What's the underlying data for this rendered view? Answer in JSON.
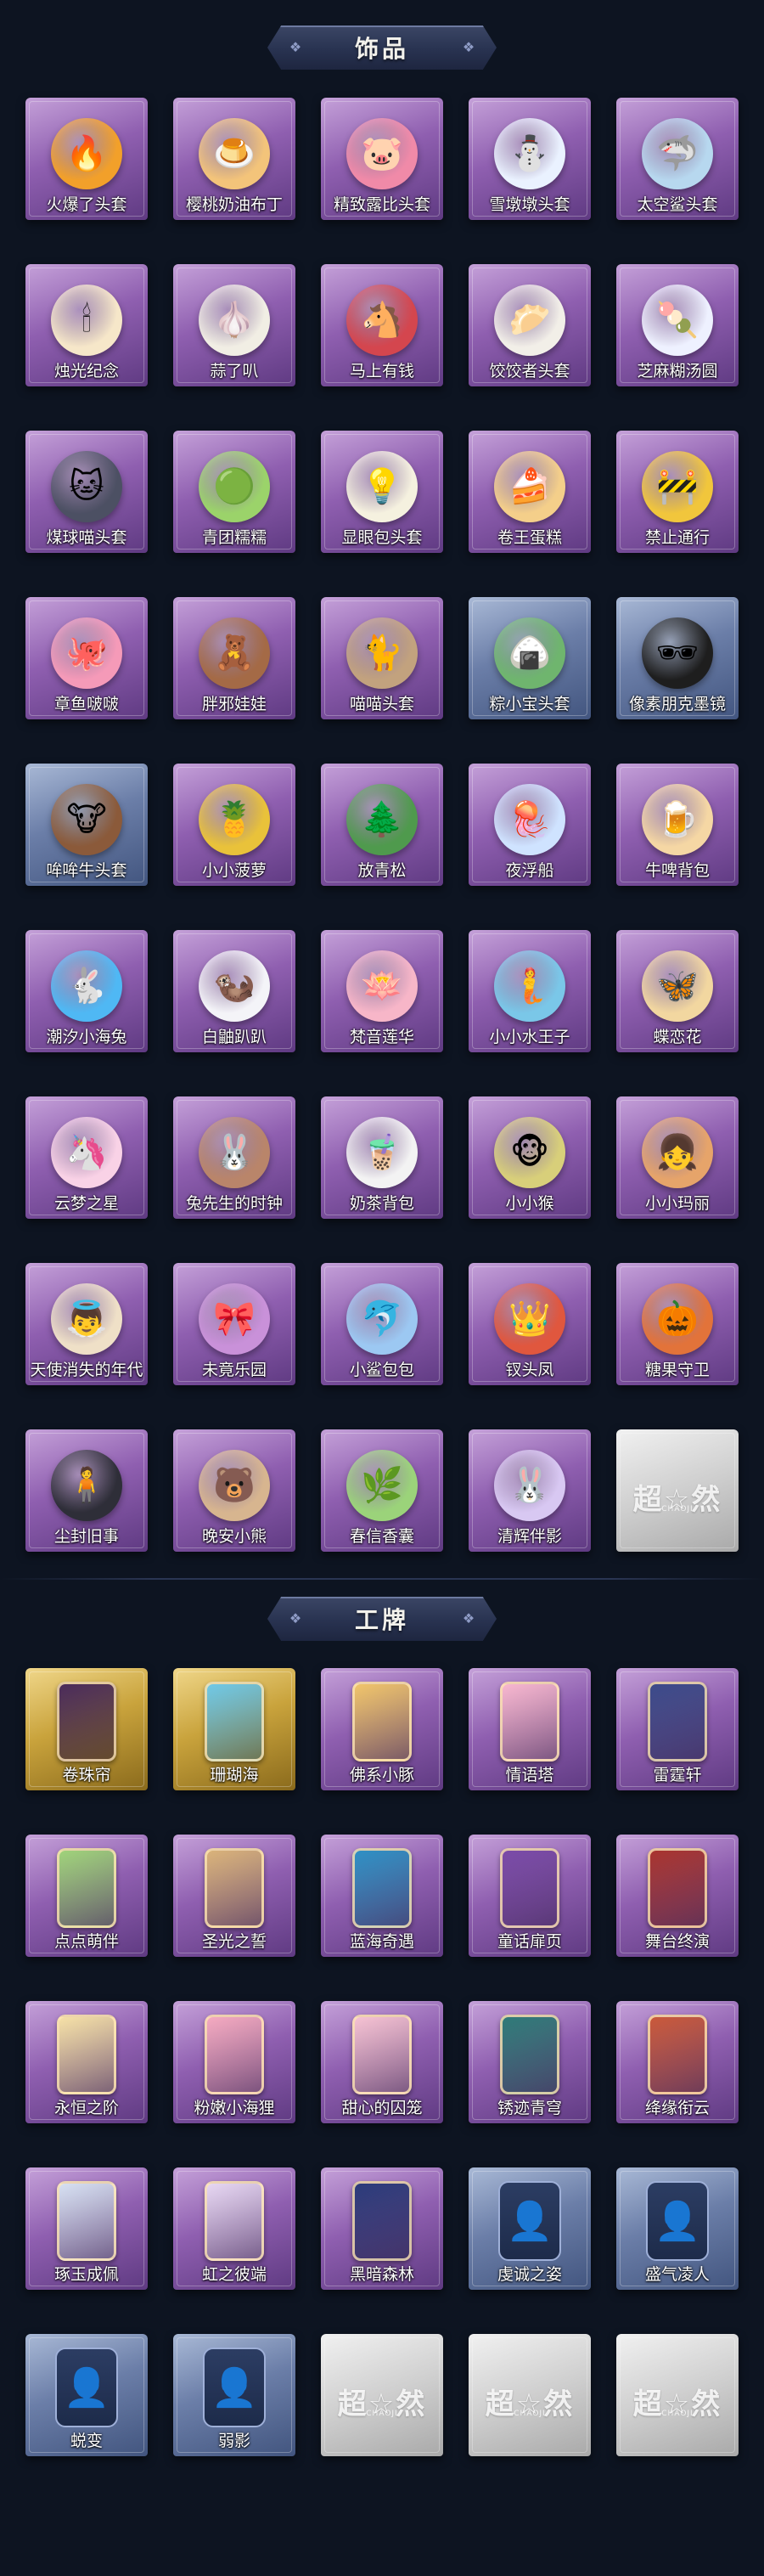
{
  "sections": [
    {
      "title": "饰品",
      "items": [
        {
          "label": "火爆了头套",
          "style": "purple",
          "icon": "🔥",
          "color": "#f2a02a"
        },
        {
          "label": "樱桃奶油布丁",
          "style": "purple",
          "icon": "🍮",
          "color": "#f3c47a"
        },
        {
          "label": "精致露比头套",
          "style": "purple",
          "icon": "🐷",
          "color": "#f08aa8"
        },
        {
          "label": "雪墩墩头套",
          "style": "purple",
          "icon": "⛄",
          "color": "#eaf2ff"
        },
        {
          "label": "太空鲨头套",
          "style": "purple",
          "icon": "🦈",
          "color": "#b7d8ef"
        },
        {
          "label": "烛光纪念",
          "style": "purple",
          "icon": "🕯",
          "color": "#f6e7c9"
        },
        {
          "label": "蒜了叭",
          "style": "purple",
          "icon": "🧄",
          "color": "#f1eee4"
        },
        {
          "label": "马上有钱",
          "style": "purple",
          "icon": "🐴",
          "color": "#d4464e"
        },
        {
          "label": "饺饺者头套",
          "style": "purple",
          "icon": "🥟",
          "color": "#f2efe8"
        },
        {
          "label": "芝麻糊汤圆",
          "style": "purple",
          "icon": "🍡",
          "color": "#eef1ff"
        },
        {
          "label": "煤球喵头套",
          "style": "purple",
          "icon": "🐱",
          "color": "#4c5063"
        },
        {
          "label": "青团糯糯",
          "style": "purple",
          "icon": "🟢",
          "color": "#9bd36a"
        },
        {
          "label": "显眼包头套",
          "style": "purple",
          "icon": "💡",
          "color": "#f5f1df"
        },
        {
          "label": "卷王蛋糕",
          "style": "purple",
          "icon": "🍰",
          "color": "#f4cf8a"
        },
        {
          "label": "禁止通行",
          "style": "purple",
          "icon": "🚧",
          "color": "#f1c63c"
        },
        {
          "label": "章鱼啵啵",
          "style": "purple",
          "icon": "🐙",
          "color": "#f59ab8"
        },
        {
          "label": "胖邪娃娃",
          "style": "purple",
          "icon": "🧸",
          "color": "#a46a46"
        },
        {
          "label": "喵喵头套",
          "style": "purple",
          "icon": "🐈",
          "color": "#c2a27e"
        },
        {
          "label": "粽小宝头套",
          "style": "blue",
          "icon": "🍙",
          "color": "#6fb56e"
        },
        {
          "label": "像素朋克墨镜",
          "style": "blue",
          "icon": "🕶",
          "color": "#1e1e1e"
        },
        {
          "label": "哞哞牛头套",
          "style": "blue",
          "icon": "🐮",
          "color": "#8b5a3a"
        },
        {
          "label": "小小菠萝",
          "style": "purple",
          "icon": "🍍",
          "color": "#e9c23a"
        },
        {
          "label": "放青松",
          "style": "purple",
          "icon": "🌲",
          "color": "#4f9a4d"
        },
        {
          "label": "夜浮船",
          "style": "purple",
          "icon": "🪼",
          "color": "#cfe3ff"
        },
        {
          "label": "牛啤背包",
          "style": "purple",
          "icon": "🍺",
          "color": "#f5d7a4"
        },
        {
          "label": "潮汐小海兔",
          "style": "purple",
          "icon": "🐇",
          "color": "#4fb8f4"
        },
        {
          "label": "白鼬趴趴",
          "style": "purple",
          "icon": "🦦",
          "color": "#f4f4f8"
        },
        {
          "label": "梵音莲华",
          "style": "purple",
          "icon": "🪷",
          "color": "#f7b6c8"
        },
        {
          "label": "小小水王子",
          "style": "purple",
          "icon": "🧜",
          "color": "#7ac7e8"
        },
        {
          "label": "蝶恋花",
          "style": "purple",
          "icon": "🦋",
          "color": "#f2d7a0"
        },
        {
          "label": "云梦之星",
          "style": "purple",
          "icon": "🦄",
          "color": "#f9d2e6"
        },
        {
          "label": "兔先生的时钟",
          "style": "purple",
          "icon": "🐰",
          "color": "#b9856a"
        },
        {
          "label": "奶茶背包",
          "style": "purple",
          "icon": "🧋",
          "color": "#f3f3f3"
        },
        {
          "label": "小小猴",
          "style": "purple",
          "icon": "🐵",
          "color": "#d8cf7a"
        },
        {
          "label": "小小玛丽",
          "style": "purple",
          "icon": "👧",
          "color": "#e6a46a"
        },
        {
          "label": "天使消失的年代",
          "style": "purple",
          "icon": "👼",
          "color": "#efe0c7"
        },
        {
          "label": "未竟乐园",
          "style": "purple",
          "icon": "🎀",
          "color": "#c991d9"
        },
        {
          "label": "小鲨包包",
          "style": "purple",
          "icon": "🐬",
          "color": "#9cc8f2"
        },
        {
          "label": "钗头凤",
          "style": "purple",
          "icon": "👑",
          "color": "#e0573e"
        },
        {
          "label": "糖果守卫",
          "style": "purple",
          "icon": "🎃",
          "color": "#e2733a"
        },
        {
          "label": "尘封旧事",
          "style": "purple",
          "icon": "🧍",
          "color": "#2e2e38"
        },
        {
          "label": "晚安小熊",
          "style": "purple",
          "icon": "🐻",
          "color": "#d7b58f"
        },
        {
          "label": "春信香囊",
          "style": "purple",
          "icon": "🌿",
          "color": "#9bd37a"
        },
        {
          "label": "清辉伴影",
          "style": "purple",
          "icon": "🐰",
          "color": "#d8c8f2"
        },
        {
          "label": "",
          "style": "gray",
          "placeholder": "超☆然",
          "placeholder_sub": "CHAOJI"
        }
      ]
    },
    {
      "title": "工牌",
      "items": [
        {
          "label": "卷珠帘",
          "style": "gold",
          "frame": "#4a2a5a"
        },
        {
          "label": "珊瑚海",
          "style": "gold",
          "frame": "#6fc8e6"
        },
        {
          "label": "佛系小豚",
          "style": "purple",
          "frame": "#f0c46a"
        },
        {
          "label": "情语塔",
          "style": "purple",
          "frame": "#f7b6cf"
        },
        {
          "label": "雷霆轩",
          "style": "purple",
          "frame": "#3b4a8a"
        },
        {
          "label": "点点萌伴",
          "style": "purple",
          "frame": "#9fd27a"
        },
        {
          "label": "圣光之誓",
          "style": "purple",
          "frame": "#d9b27a"
        },
        {
          "label": "蓝海奇遇",
          "style": "purple",
          "frame": "#2e8fc4"
        },
        {
          "label": "童话扉页",
          "style": "purple",
          "frame": "#7a4aa8"
        },
        {
          "label": "舞台终演",
          "style": "purple",
          "frame": "#a8332e"
        },
        {
          "label": "永恒之阶",
          "style": "purple",
          "frame": "#f5e0a6"
        },
        {
          "label": "粉嫩小海狸",
          "style": "purple",
          "frame": "#f4a9c0"
        },
        {
          "label": "甜心的囚笼",
          "style": "purple",
          "frame": "#f5c1d2"
        },
        {
          "label": "锈迹青穹",
          "style": "purple",
          "frame": "#2e7a78"
        },
        {
          "label": "绛缘衔云",
          "style": "purple",
          "frame": "#c9583a"
        },
        {
          "label": "琢玉成佩",
          "style": "purple",
          "frame": "#d6e0f2"
        },
        {
          "label": "虹之彼端",
          "style": "purple",
          "frame": "#e6d6f2"
        },
        {
          "label": "黑暗森林",
          "style": "purple",
          "frame": "#2a3a7a"
        },
        {
          "label": "虔诚之姿",
          "style": "blue",
          "silhouette": "👤"
        },
        {
          "label": "盛气凌人",
          "style": "blue",
          "silhouette": "👤"
        },
        {
          "label": "蜕变",
          "style": "blue",
          "silhouette": "👤"
        },
        {
          "label": "弱影",
          "style": "blue",
          "silhouette": "👤"
        },
        {
          "label": "",
          "style": "gray",
          "placeholder": "超☆然",
          "placeholder_sub": "CHAOJI"
        },
        {
          "label": "",
          "style": "gray",
          "placeholder": "超☆然",
          "placeholder_sub": "CHAOJI"
        },
        {
          "label": "",
          "style": "gray",
          "placeholder": "超☆然",
          "placeholder_sub": "CHAOJI"
        }
      ]
    }
  ]
}
